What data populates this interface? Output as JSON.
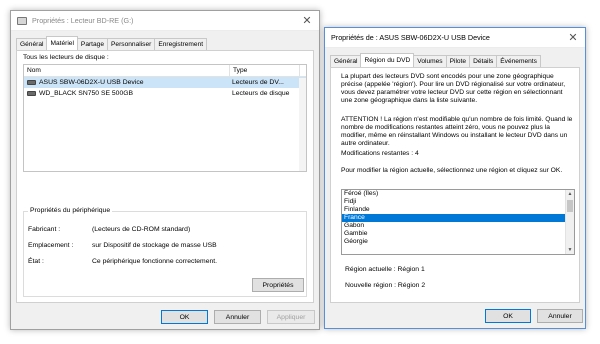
{
  "win1": {
    "title": "Propriétés : Lecteur BD-RE (G:)",
    "close_glyph": "✕",
    "tabs": [
      "Général",
      "Matériel",
      "Partage",
      "Personnaliser",
      "Enregistrement"
    ],
    "active_tab": "Matériel",
    "devices_label": "Tous les lecteurs de disque :",
    "columns": [
      "Nom",
      "Type"
    ],
    "rows": [
      {
        "name": "ASUS SBW-06D2X-U USB Device",
        "type": "Lecteurs de DV..."
      },
      {
        "name": "WD_BLACK SN750 SE 500GB",
        "type": "Lecteurs de disque"
      }
    ],
    "group_title": "Propriétés du périphérique",
    "props": [
      {
        "label": "Fabricant :",
        "value": "(Lecteurs de CD-ROM standard)"
      },
      {
        "label": "Emplacement :",
        "value": "sur Dispositif de stockage de masse USB"
      },
      {
        "label": "État :",
        "value": "Ce périphérique fonctionne correctement."
      }
    ],
    "properties_button": "Propriétés",
    "ok": "OK",
    "cancel": "Annuler",
    "apply": "Appliquer"
  },
  "win2": {
    "title": "Propriétés de : ASUS SBW-06D2X-U USB Device",
    "close_glyph": "✕",
    "tabs": [
      "Général",
      "Région du DVD",
      "Volumes",
      "Pilote",
      "Détails",
      "Événements"
    ],
    "active_tab": "Région du DVD",
    "intro": "La plupart des lecteurs DVD sont encodés pour une zone géographique précise (appelée 'région'). Pour lire un DVD régionalisé sur votre ordinateur, vous devez paramétrer votre lecteur DVD sur cette région en sélectionnant une zone géographique dans la liste suivante.",
    "warning": "ATTENTION ! La région n'est modifiable qu'un nombre de fois limité. Quand le nombre de modifications restantes atteint zéro, vous ne pouvez plus la modifier, même en réinstallant Windows ou installant le lecteur DVD dans un autre ordinateur.",
    "remaining": "Modifications restantes : 4",
    "instruction": "Pour modifier la région actuelle, sélectionnez une région et cliquez sur OK.",
    "regions": [
      "Féroé (Îles)",
      "Fidji",
      "Finlande",
      "France",
      "Gabon",
      "Gambie",
      "Géorgie"
    ],
    "selected_region": "France",
    "current_region": "Région actuelle : Région 1",
    "new_region": "Nouvelle région : Région 2",
    "ok": "OK",
    "cancel": "Annuler"
  }
}
